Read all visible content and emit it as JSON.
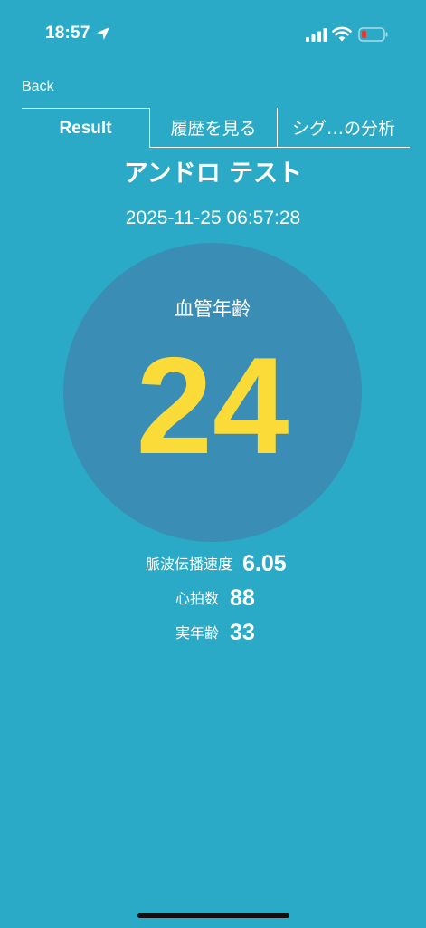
{
  "status_bar": {
    "time": "18:57",
    "icons": [
      "location-arrow-icon",
      "cellular-signal-icon",
      "wifi-icon",
      "battery-low-icon"
    ],
    "battery_color": "#E53935"
  },
  "nav": {
    "back_label": "Back"
  },
  "tabs": [
    {
      "label": "Result",
      "active": true
    },
    {
      "label": "履歴を見る",
      "active": false
    },
    {
      "label": "シグ…の分析",
      "active": false
    }
  ],
  "result": {
    "title": "アンドロ テスト",
    "timestamp": "2025-11-25 06:57:28",
    "vascular_age_label": "血管年齢",
    "vascular_age_value": "24",
    "metrics": [
      {
        "label": "脈波伝播速度",
        "value": "6.05"
      },
      {
        "label": "心拍数",
        "value": "88"
      },
      {
        "label": "実年齢",
        "value": "33"
      }
    ]
  },
  "colors": {
    "background": "#2AAAC6",
    "circle": "#3A8DB5",
    "accent_value": "#FBDB38",
    "text": "#FFFFFF"
  }
}
